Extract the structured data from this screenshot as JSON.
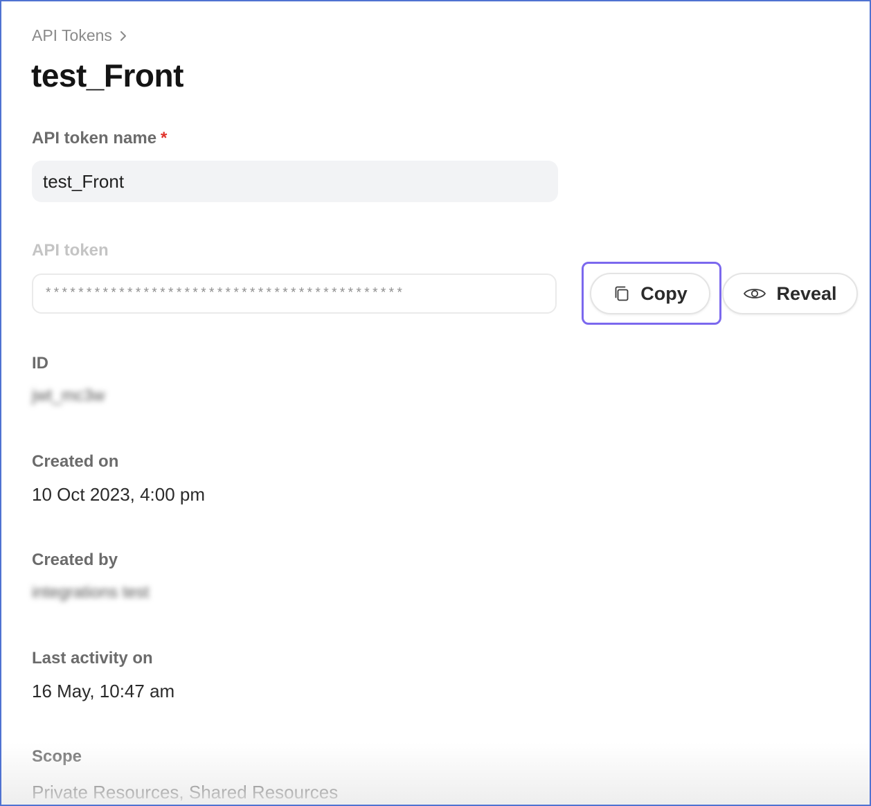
{
  "breadcrumb": {
    "parent": "API Tokens"
  },
  "page": {
    "title": "test_Front"
  },
  "form": {
    "name_label": "API token name",
    "required_marker": "*",
    "name_value": "test_Front",
    "token_label": "API token",
    "token_value": "********************************************"
  },
  "actions": {
    "copy_label": "Copy",
    "reveal_label": "Reveal"
  },
  "details": {
    "id_label": "ID",
    "id_value": "jwt_mc3w",
    "created_on_label": "Created on",
    "created_on_value": "10 Oct 2023, 4:00 pm",
    "created_by_label": "Created by",
    "created_by_value": "integrations test",
    "last_activity_label": "Last activity on",
    "last_activity_value": "16 May, 10:47 am",
    "scope_label": "Scope",
    "scope_value": "Private Resources, Shared Resources"
  },
  "colors": {
    "highlight": "#7b68ee",
    "required": "#e0322a",
    "frame": "#4f72d1"
  },
  "icons": {
    "breadcrumb_separator": "chevron-right-icon",
    "copy": "copy-icon",
    "reveal": "eye-icon"
  }
}
